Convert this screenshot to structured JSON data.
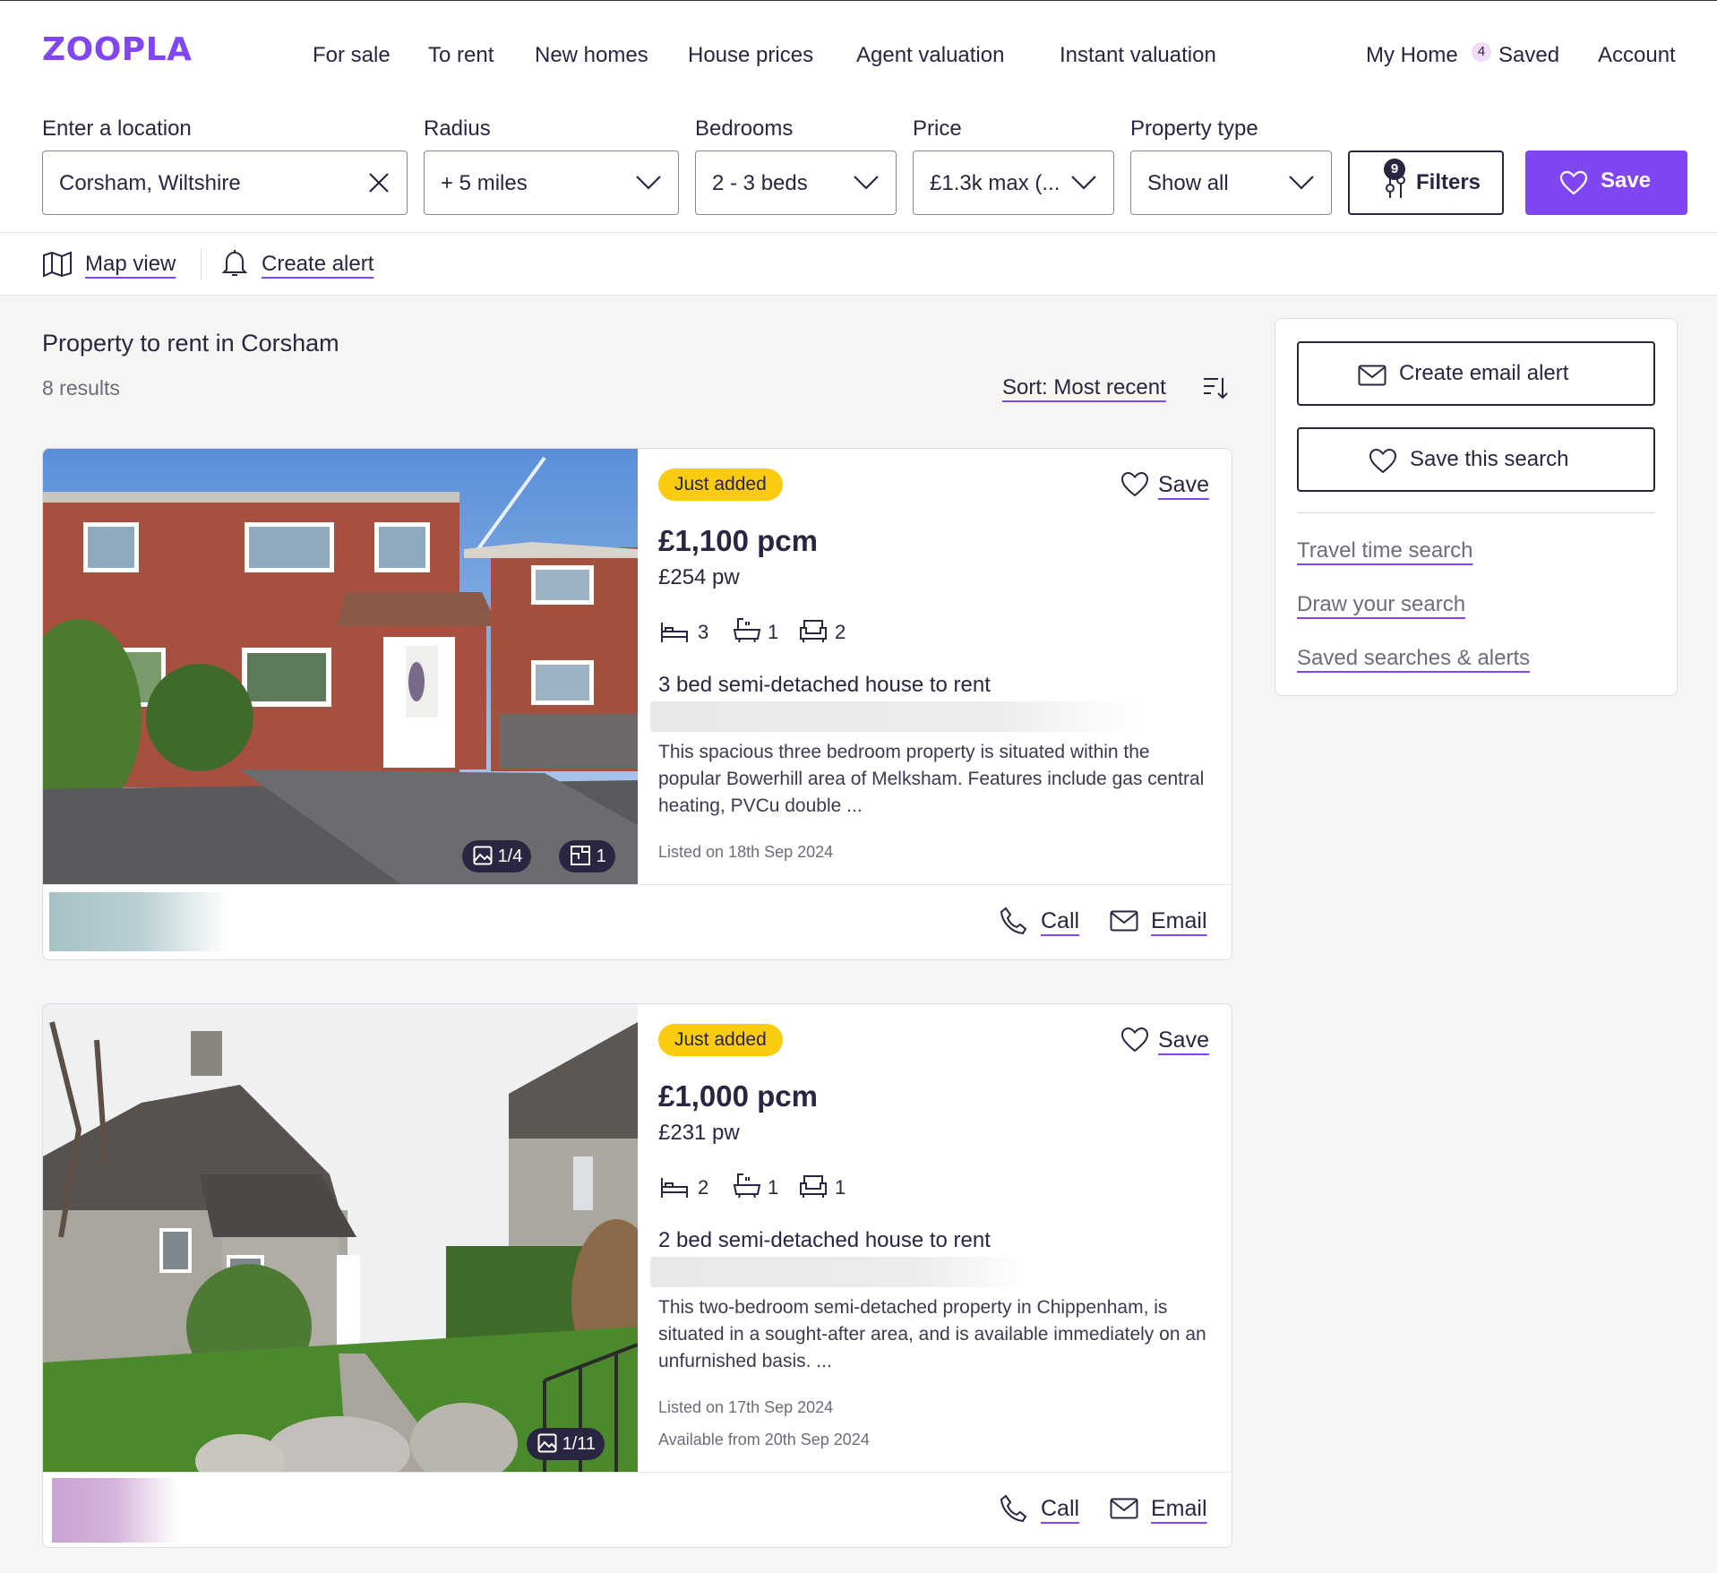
{
  "header": {
    "logo": "ZOOPLA",
    "nav": [
      "For sale",
      "To rent",
      "New homes",
      "House prices",
      "Agent valuation",
      "Instant valuation"
    ],
    "my_home": "My Home",
    "my_home_badge": "4",
    "saved": "Saved",
    "account": "Account"
  },
  "search": {
    "location_label": "Enter a location",
    "location_value": "Corsham, Wiltshire",
    "radius_label": "Radius",
    "radius_value": "+ 5 miles",
    "bedrooms_label": "Bedrooms",
    "bedrooms_value": "2 - 3 beds",
    "price_label": "Price",
    "price_value": "£1.3k max (...",
    "type_label": "Property type",
    "type_value": "Show all",
    "filters_label": "Filters",
    "filters_count": "9",
    "save_label": "Save"
  },
  "toolbar": {
    "map_view": "Map view",
    "create_alert": "Create alert"
  },
  "results": {
    "title": "Property to rent in Corsham",
    "count": "8 results",
    "sort": "Sort: Most recent"
  },
  "listings": [
    {
      "tag": "Just added",
      "save": "Save",
      "price_pcm": "£1,100 pcm",
      "price_pw": "£254 pw",
      "beds": "3",
      "baths": "1",
      "receptions": "2",
      "title": "3 bed semi-detached house to rent",
      "description": "This spacious three bedroom property is situated within the popular Bowerhill area of Melksham. Features include gas central heating, PVCu double ...",
      "listed": "Listed on 18th Sep 2024",
      "available": "",
      "photo_count": "1/4",
      "floorplan_count": "1",
      "call": "Call",
      "email": "Email"
    },
    {
      "tag": "Just added",
      "save": "Save",
      "price_pcm": "£1,000 pcm",
      "price_pw": "£231 pw",
      "beds": "2",
      "baths": "1",
      "receptions": "1",
      "title": "2 bed semi-detached house to rent",
      "description": "This two-bedroom semi-detached property in Chippenham, is situated in a sought-after area, and is available immediately on an unfurnished basis. ...",
      "listed": "Listed on 17th Sep 2024",
      "available": "Available from 20th Sep 2024",
      "photo_count": "1/11",
      "call": "Call",
      "email": "Email"
    }
  ],
  "sidebar": {
    "email_alert": "Create email alert",
    "save_search": "Save this search",
    "links": [
      "Travel time search",
      "Draw your search",
      "Saved searches & alerts"
    ]
  },
  "colors": {
    "brand": "#8046f1",
    "text": "#2a2541",
    "tag": "#fbcb11",
    "page_bg": "#f6f5f3"
  }
}
